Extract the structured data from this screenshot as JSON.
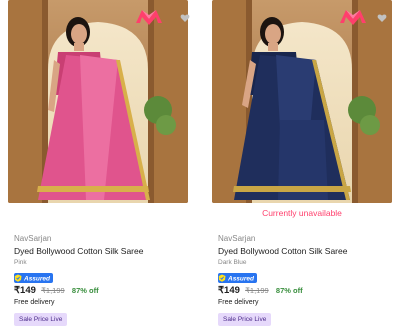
{
  "products": [
    {
      "brand": "NavSarjan",
      "title": "Dyed Bollywood Cotton Silk Saree",
      "color": "Pink",
      "assured_label": "Assured",
      "price": "₹149",
      "mrp": "₹1,199",
      "discount": "87% off",
      "delivery": "Free delivery",
      "tag": "Sale Price Live",
      "status": "",
      "saree_color": "#e0548d"
    },
    {
      "brand": "NavSarjan",
      "title": "Dyed Bollywood Cotton Silk Saree",
      "color": "Dark Blue",
      "assured_label": "Assured",
      "price": "₹149",
      "mrp": "₹1,199",
      "discount": "87% off",
      "delivery": "Free delivery",
      "tag": "Sale Price Live",
      "status": "Currently unavailable",
      "saree_color": "#1f2e5c"
    }
  ],
  "colors": {
    "brand_logo": "#ff3f6c",
    "discount": "#388e3c",
    "unavailable": "#ff3f6c",
    "assured_badge": "#2874f0",
    "sale_tag_bg": "#e6d9fb"
  },
  "icons": {
    "wishlist": "heart-icon",
    "brand_logo": "myntra-logo",
    "assured": "assured-badge-icon"
  }
}
